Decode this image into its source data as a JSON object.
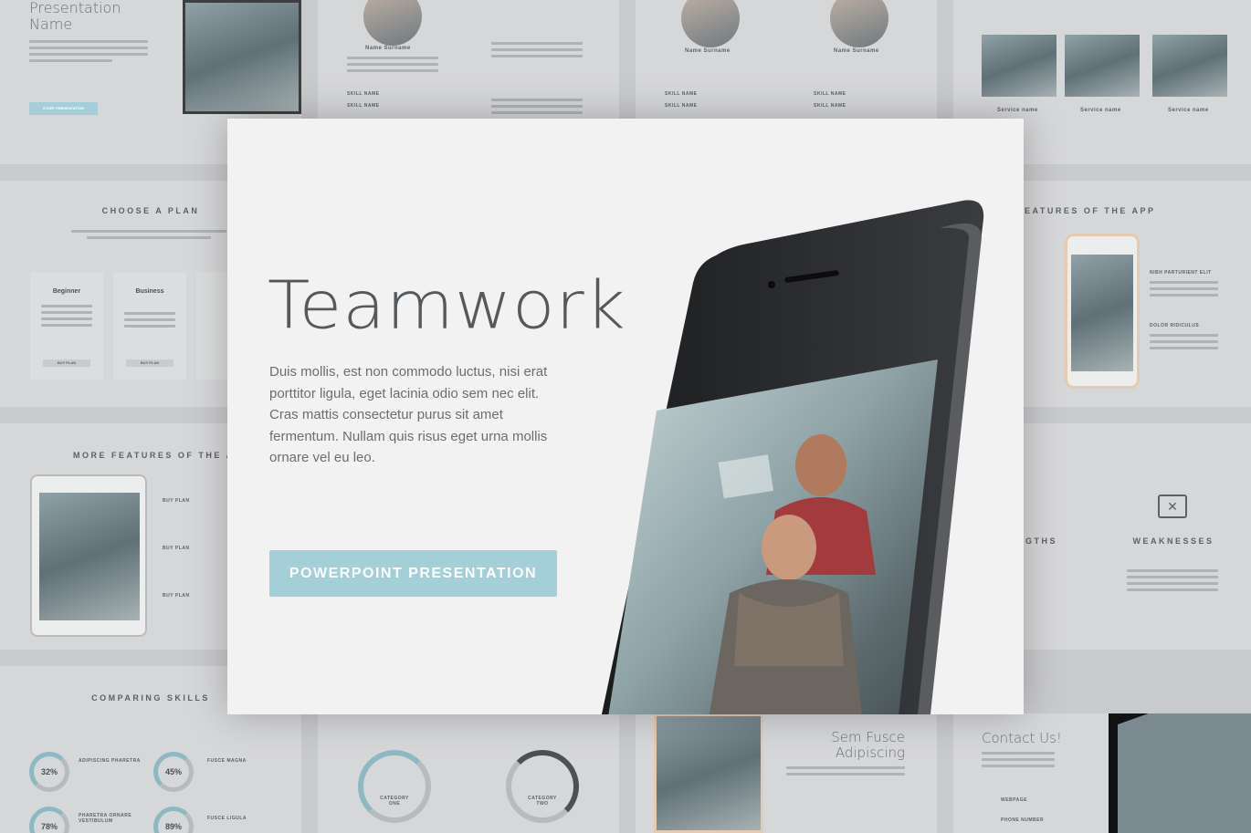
{
  "hero": {
    "title": "Teamwork",
    "body": "Duis mollis, est non commodo luctus, nisi erat porttitor ligula, eget lacinia odio sem nec elit. Cras mattis consectetur purus sit amet fermentum. Nullam quis risus eget urna mollis ornare vel eu leo.",
    "cta_label": "POWERPOINT PRESENTATION"
  },
  "background_slides": {
    "presentation_name": "Presentation Name",
    "start_button": "START PRESENTATION",
    "team": [
      {
        "name": "Name Surname",
        "skills": [
          "SKILL NAME",
          "SKILL NAME"
        ]
      },
      {
        "name": "Name Surname",
        "skills": [
          "SKILL NAME",
          "SKILL NAME"
        ]
      },
      {
        "name": "Name Surname",
        "skills": [
          "SKILL NAME",
          "SKILL NAME"
        ]
      }
    ],
    "services": [
      "Service name",
      "Service name",
      "Service name"
    ],
    "choose_plan": {
      "title": "CHOOSE A PLAN",
      "plans": [
        {
          "name": "Beginner",
          "button": "BUY PLAN"
        },
        {
          "name": "Business",
          "button": "BUY PLAN"
        }
      ]
    },
    "features_app": {
      "title": "FEATURES OF THE APP",
      "items": [
        "NIBH PARTURIENT ELIT",
        "DOLOR RIDICULUS"
      ]
    },
    "more_features": {
      "title": "MORE FEATURES OF THE APP",
      "items": [
        "BUY PLAN",
        "BUY PLAN",
        "BUY PLAN"
      ]
    },
    "swot": {
      "strengths_fragment": "NGTHS",
      "weaknesses": "WEAKNESSES"
    },
    "comparing_skills": {
      "title": "COMPARING SKILLS",
      "items": [
        {
          "value": "32%",
          "label": "ADIPISCING PHARETRA"
        },
        {
          "value": "45%",
          "label": "FUSCE MAGNA"
        },
        {
          "value": "78%",
          "label": "PHARETRA ORNARE VESTIBULUM"
        },
        {
          "value": "89%",
          "label": "FUSCE LIGULA"
        }
      ]
    },
    "categories": [
      "CATEGORY ONE",
      "CATEGORY TWO"
    ],
    "sem_fusce": "Sem Fusce Adipiscing",
    "contact": {
      "title": "Contact Us!",
      "webpage": "WEBPAGE",
      "phone": "PHONE NUMBER"
    }
  }
}
